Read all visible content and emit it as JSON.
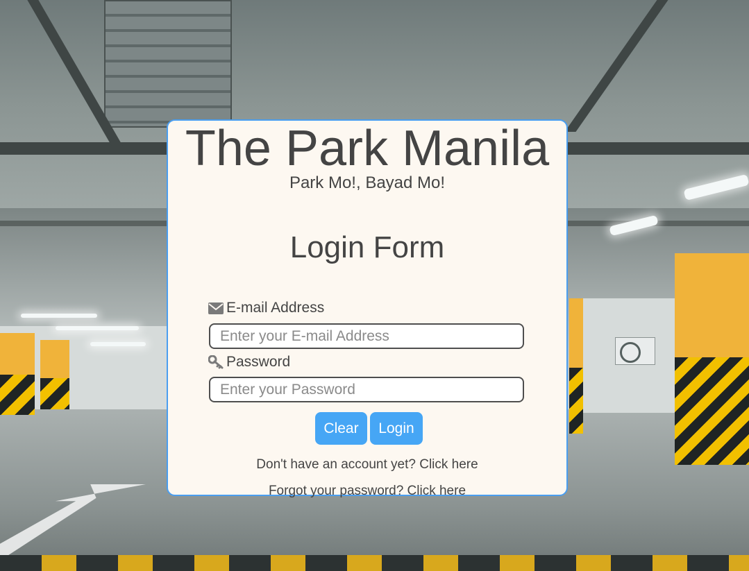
{
  "header": {
    "title": "The Park Manila",
    "tagline": "Park Mo!, Bayad Mo!"
  },
  "form": {
    "title": "Login Form",
    "email_label": "E-mail Address",
    "email_placeholder": "Enter your E-mail Address",
    "email_value": "",
    "password_label": "Password",
    "password_placeholder": "Enter your Password",
    "password_value": "",
    "clear_label": "Clear",
    "login_label": "Login",
    "signup_prompt": "Don't have an account yet? ",
    "signup_link": "Click here",
    "forgot_prompt": "Forgot your password? ",
    "forgot_link": "Click here"
  },
  "icons": {
    "email": "envelope-icon",
    "password": "key-icon"
  },
  "colors": {
    "accent": "#46a6f5",
    "card_border": "#4a9ef0",
    "card_background": "#fdf8f1",
    "text": "#444444"
  }
}
